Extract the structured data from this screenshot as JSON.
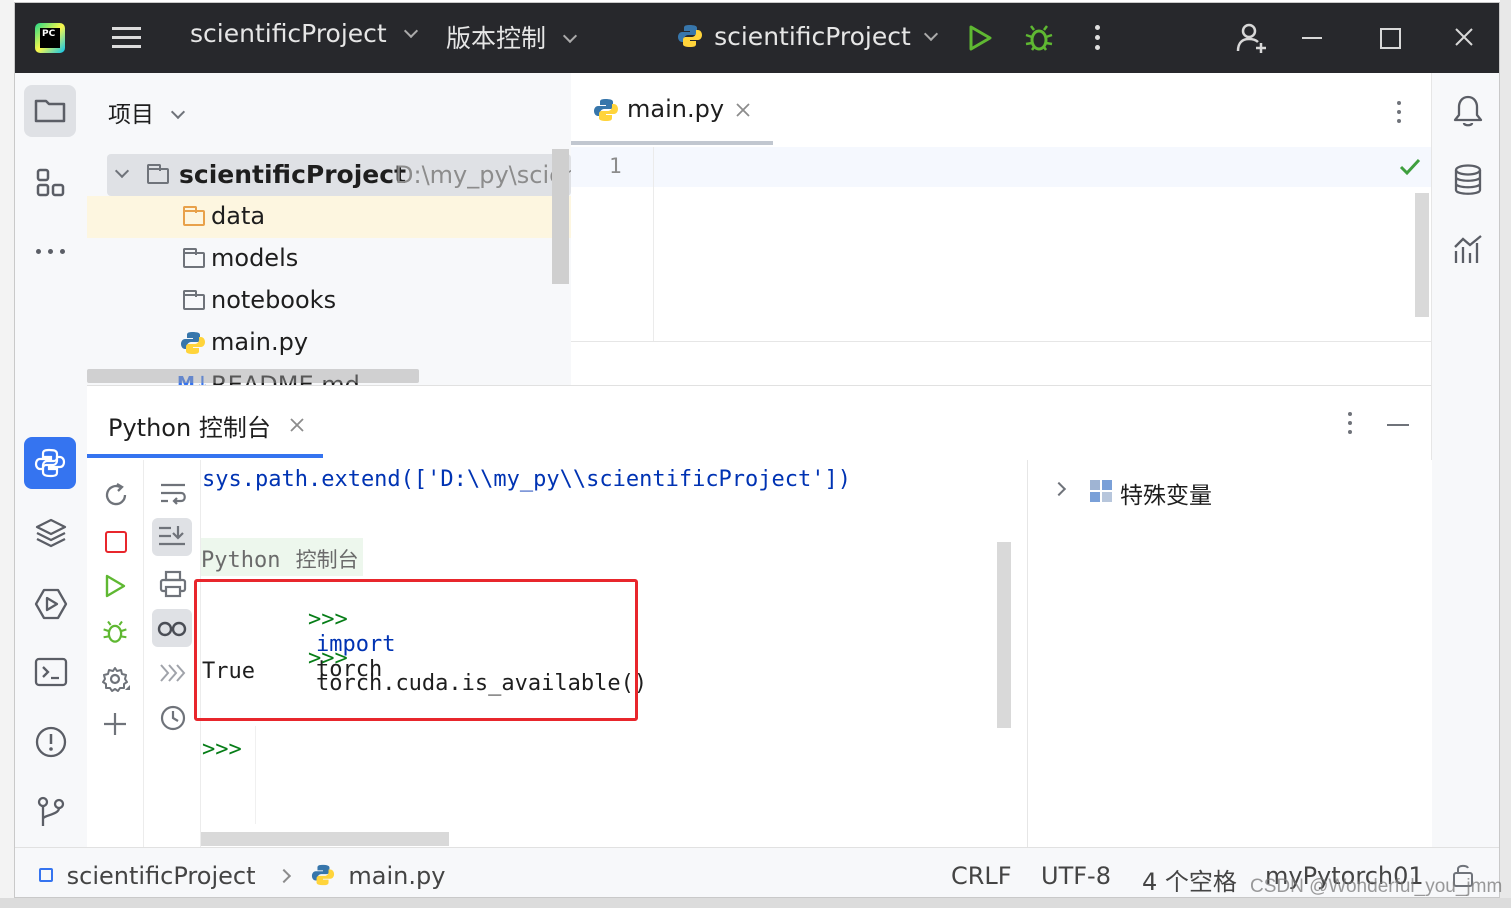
{
  "titlebar": {
    "app_logo": "PC",
    "project_name": "scientificProject",
    "vcs_label": "版本控制",
    "run_config": "scientificProject"
  },
  "project_panel": {
    "title": "项目",
    "root_name": "scientificProject",
    "root_path": "D:\\my_py\\scien",
    "items": [
      {
        "label": "data"
      },
      {
        "label": "models"
      },
      {
        "label": "notebooks"
      },
      {
        "label": "main.py"
      },
      {
        "label": "README.md"
      }
    ]
  },
  "editor": {
    "tab_label": "main.py",
    "line_number": "1"
  },
  "console": {
    "tab_label": "Python 控制台",
    "lines": {
      "sys_path": "sys.path.extend(['D:\\\\my_py\\\\scientificProject'])",
      "banner_python": "Python",
      "banner_console": "控制台",
      "prompt1": ">>>",
      "cmd1_keyword": "import",
      "cmd1_rest": "torch",
      "prompt2": ">>>",
      "cmd2": "torch.cuda.is_available()",
      "output": "True",
      "prompt3": ">>>"
    },
    "variables_label": "特殊变量"
  },
  "statusbar": {
    "crumb_project": "scientificProject",
    "crumb_file": "main.py",
    "line_ending": "CRLF",
    "encoding": "UTF-8",
    "indent": "4 个空格",
    "interpreter": "myPytorch01"
  },
  "watermark": "CSDN @Wonderful_you_jmm",
  "colors": {
    "accent": "#3574f0",
    "highlight_box": "#e8262c",
    "keyword": "#0033b3",
    "prompt": "#067d17",
    "run_green": "#5fb832"
  }
}
